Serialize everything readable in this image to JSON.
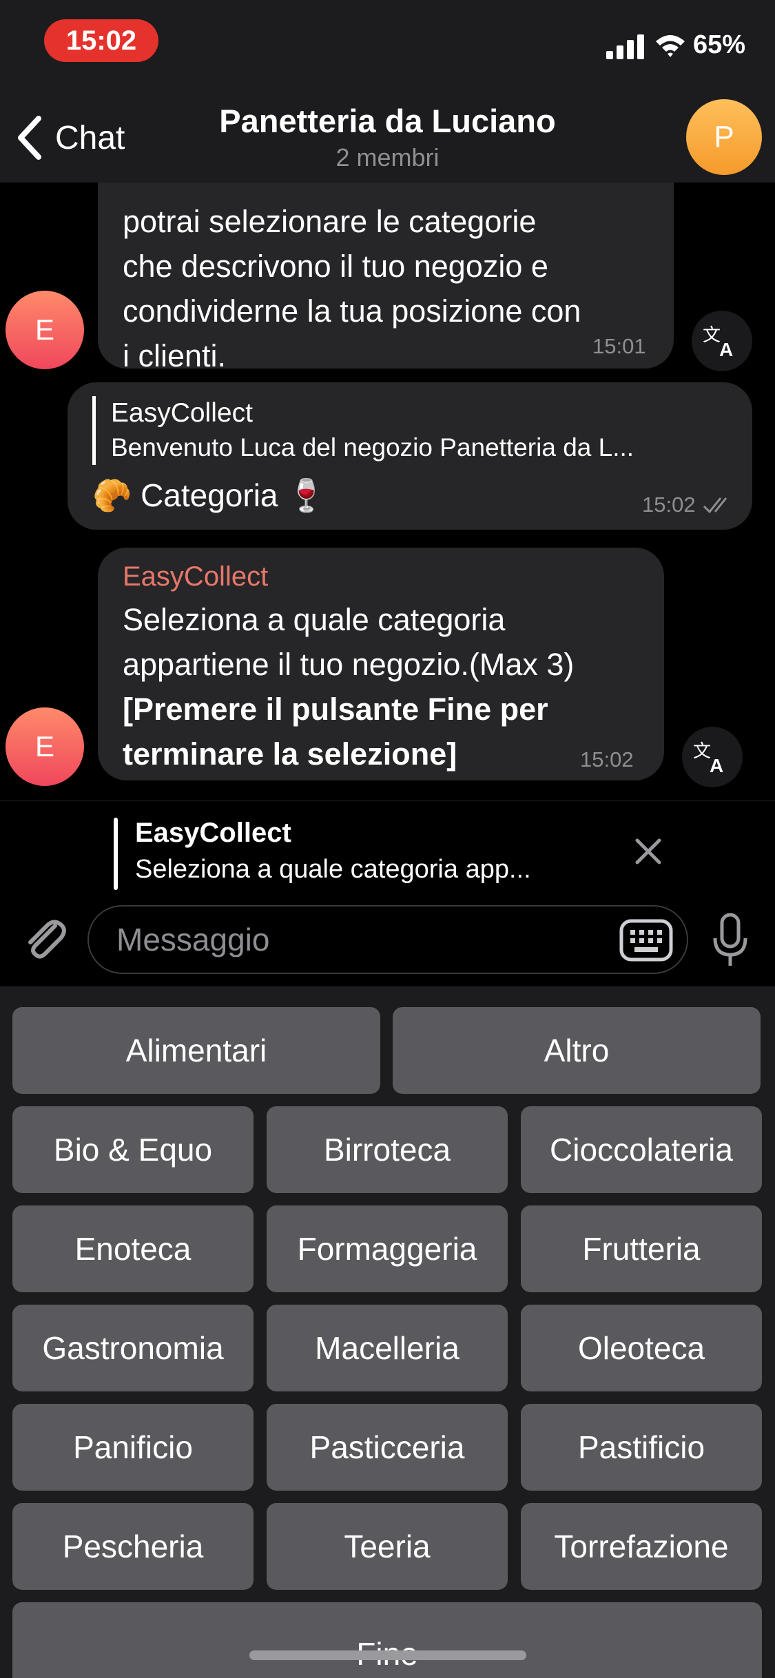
{
  "status_bar": {
    "time": "15:02",
    "battery": "65%"
  },
  "header": {
    "back_label": "Chat",
    "title": "Panetteria da Luciano",
    "subtitle": "2 membri",
    "avatar_initial": "P"
  },
  "messages": [
    {
      "sender_initial": "E",
      "lines": [
        "potrai selezionare le categorie",
        "che descrivono il tuo negozio e",
        "condividerne la tua posizione con",
        "i clienti."
      ],
      "time": "15:01"
    },
    {
      "reply_to": {
        "name": "EasyCollect",
        "text": "Benvenuto Luca  del negozio Panetteria da L..."
      },
      "text_prefix_emoji": "🥐",
      "text": "Categoria",
      "text_suffix_emoji": "🍷",
      "time": "15:02"
    },
    {
      "sender_initial": "E",
      "sender_name": "EasyCollect",
      "lines": [
        "Seleziona a quale categoria",
        "appartiene il tuo negozio.(Max 3)"
      ],
      "bold_lines": [
        "[Premere il pulsante Fine per",
        "terminare la selezione]"
      ],
      "time": "15:02"
    }
  ],
  "reply_bar": {
    "name": "EasyCollect",
    "text": "Seleziona a quale categoria app..."
  },
  "composer": {
    "placeholder": "Messaggio"
  },
  "keyboard": {
    "rows": [
      [
        "Alimentari",
        "Altro"
      ],
      [
        "Bio & Equo",
        "Birroteca",
        "Cioccolateria"
      ],
      [
        "Enoteca",
        "Formaggeria",
        "Frutteria"
      ],
      [
        "Gastronomia",
        "Macelleria",
        "Oleoteca"
      ],
      [
        "Panificio",
        "Pasticceria",
        "Pastificio"
      ],
      [
        "Pescheria",
        "Teeria",
        "Torrefazione"
      ],
      [
        "Fine"
      ]
    ]
  },
  "colors": {
    "accent_sender": "#e8776a",
    "keyboard_button": "#5a5a5e",
    "time_pill": "#e5322d",
    "avatar_p": "#f7a83a",
    "avatar_e": "#f55a62"
  },
  "icons": [
    "back-chevron-icon",
    "signal-icon",
    "wifi-icon",
    "translate-icon",
    "close-icon",
    "paperclip-icon",
    "keyboard-icon",
    "microphone-icon",
    "double-check-icon"
  ]
}
